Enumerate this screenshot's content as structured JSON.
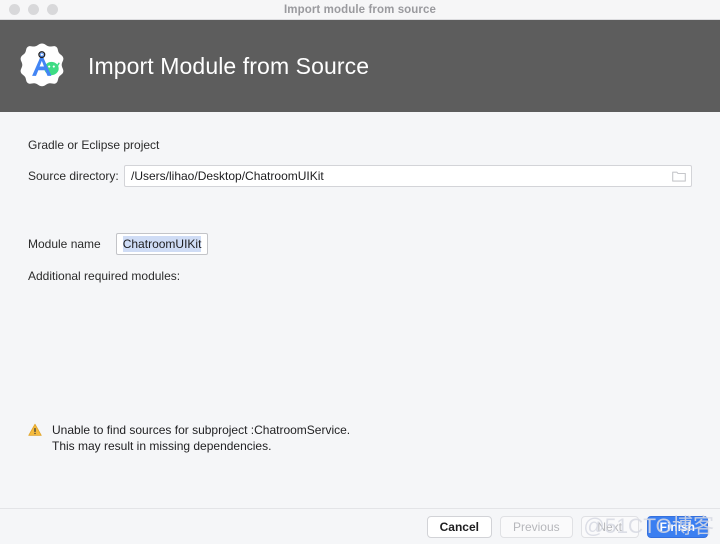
{
  "window": {
    "titlebar_text": "Import module from source",
    "traffic_lights": [
      "close",
      "minimize",
      "maximize"
    ]
  },
  "header": {
    "title": "Import Module from Source",
    "logo_icon": "android-studio-icon",
    "background_color": "#5d5d5d"
  },
  "form": {
    "section_label": "Gradle or Eclipse project",
    "source_directory": {
      "label": "Source directory:",
      "value": "/Users/lihao/Desktop/ChatroomUIKit",
      "placeholder": "",
      "browse_icon": "folder-icon"
    },
    "module_name": {
      "label": "Module name",
      "value": "ChatroomUIKit",
      "selected": true,
      "selection_color": "#cfdcf5"
    },
    "additional_modules_label": "Additional required modules:"
  },
  "warning": {
    "icon": "warning-triangle-icon",
    "icon_color": "#f0b429",
    "line1": "Unable to find sources for subproject :ChatroomService.",
    "line2": "This may result in missing dependencies."
  },
  "footer": {
    "buttons": [
      {
        "label": "Cancel",
        "state": "enabled",
        "style": "default"
      },
      {
        "label": "Previous",
        "state": "disabled",
        "style": "default"
      },
      {
        "label": "Next",
        "state": "disabled",
        "style": "default"
      },
      {
        "label": "Finish",
        "state": "enabled",
        "style": "primary"
      }
    ],
    "primary_color": "#3b7ff1"
  },
  "watermark": {
    "text": "@51CTO博客"
  }
}
